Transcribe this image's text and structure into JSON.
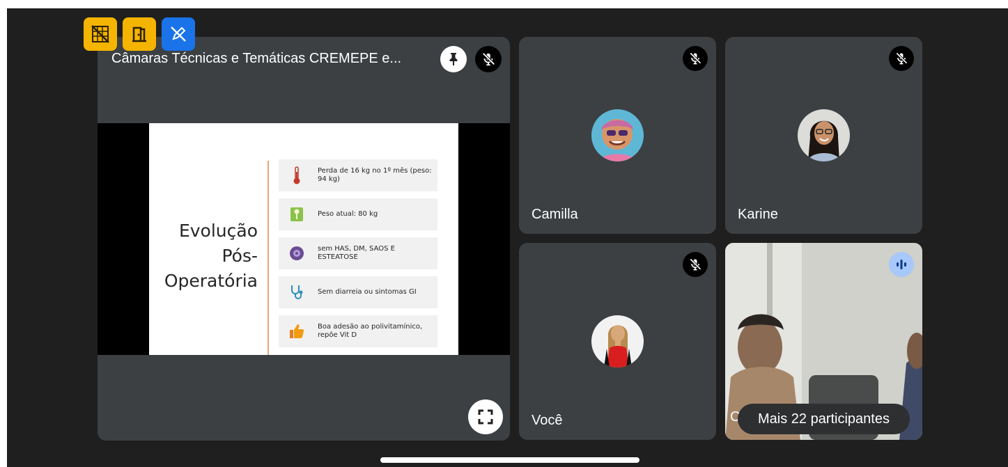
{
  "meeting": {
    "presentation_title": "Câmaras Técnicas e Temáticas CREMEPE e..."
  },
  "slide": {
    "heading": "Evolução Pós-Operatória",
    "items": [
      {
        "icon": "thermometer-icon",
        "text": "Perda de 16 kg no 1º mês (peso: 94 kg)"
      },
      {
        "icon": "scale-icon",
        "text": "Peso atual: 80 kg"
      },
      {
        "icon": "virus-icon",
        "text": "sem HAS, DM, SAOS E ESTEATOSE"
      },
      {
        "icon": "stethoscope-icon",
        "text": "Sem diarreia ou sintomas GI"
      },
      {
        "icon": "thumbs-up-icon",
        "text": "Boa adesão ao polivitamínico, repõe Vit D"
      }
    ]
  },
  "participants": {
    "camilla": "Camilla",
    "karine": "Karine",
    "voce": "Você",
    "video_partial": "C"
  },
  "more_participants": "Mais 22 participantes",
  "icons": {
    "pin": "pin-icon",
    "mic_off": "mic-off-icon",
    "fullscreen": "fullscreen-icon",
    "speaking": "audio-wave-icon"
  },
  "colors": {
    "background": "#1f1f1f",
    "tile": "#3c4043",
    "speaking_indicator": "#a8c7fa",
    "overlay_yellow": "#f5b400",
    "overlay_blue": "#1a73e8"
  }
}
